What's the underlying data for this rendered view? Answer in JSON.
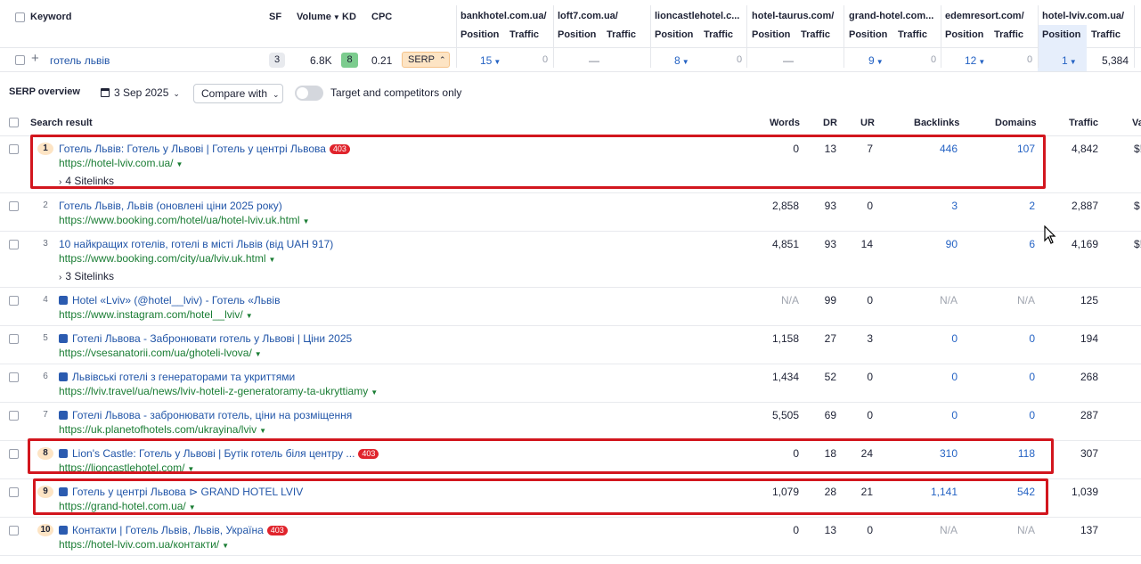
{
  "keyword_table": {
    "headers": {
      "keyword": "Keyword",
      "sf": "SF",
      "volume": "Volume",
      "kd": "KD",
      "cpc": "CPC"
    },
    "competitors": [
      {
        "domain": "bankhotel.com.ua/",
        "position": "15",
        "traffic": "0"
      },
      {
        "domain": "loft7.com.ua/",
        "position": "—",
        "traffic": ""
      },
      {
        "domain": "lioncastlehotel.c...",
        "position": "8",
        "traffic": "0"
      },
      {
        "domain": "hotel-taurus.com/",
        "position": "—",
        "traffic": ""
      },
      {
        "domain": "grand-hotel.com...",
        "position": "9",
        "traffic": "0"
      },
      {
        "domain": "edemresort.com/",
        "position": "12",
        "traffic": "0"
      },
      {
        "domain": "hotel-lviv.com.ua/",
        "position": "1",
        "traffic": "5,384"
      }
    ],
    "sub_headers": {
      "position": "Position",
      "traffic": "Traffic"
    },
    "row": {
      "keyword": "готель львів",
      "sf": "3",
      "volume": "6.8K",
      "kd": "8",
      "cpc": "0.21",
      "serp": "SERP"
    }
  },
  "toolbar": {
    "title": "SERP overview",
    "date": "3 Sep 2025",
    "compare": "Compare with",
    "toggle_label": "Target and competitors only"
  },
  "results_header": {
    "search_result": "Search result",
    "words": "Words",
    "dr": "DR",
    "ur": "UR",
    "backlinks": "Backlinks",
    "domains": "Domains",
    "traffic": "Traffic",
    "value": "Va"
  },
  "results": [
    {
      "rank": "1",
      "title": "Готель Львів: Готель у Львові | Готель у центрі Львова",
      "badge": "403",
      "url": "https://hotel-lviv.com.ua/",
      "sitelinks": "4 Sitelinks",
      "words": "0",
      "dr": "13",
      "ur": "7",
      "backlinks": "446",
      "domains": "107",
      "traffic": "4,842",
      "value": "$!"
    },
    {
      "rank": "2",
      "title": "Готель Львів, Львів (оновлені ціни 2025 року)",
      "url": "https://www.booking.com/hotel/ua/hotel-lviv.uk.html",
      "words": "2,858",
      "dr": "93",
      "ur": "0",
      "backlinks": "3",
      "domains": "2",
      "traffic": "2,887",
      "value": "$"
    },
    {
      "rank": "3",
      "title": "10 найкращих готелів, готелі в місті Львів (від UAH 917)",
      "url": "https://www.booking.com/city/ua/lviv.uk.html",
      "sitelinks": "3 Sitelinks",
      "words": "4,851",
      "dr": "93",
      "ur": "14",
      "backlinks": "90",
      "domains": "6",
      "traffic": "4,169",
      "value": "$!"
    },
    {
      "rank": "4",
      "title": "Hotel «Lviv» (@hotel__lviv) - Готель «Львів",
      "url": "https://www.instagram.com/hotel__lviv/",
      "words": "N/A",
      "dr": "99",
      "ur": "0",
      "backlinks": "N/A",
      "domains": "N/A",
      "traffic": "125",
      "value": ""
    },
    {
      "rank": "5",
      "title": "Готелі Львова - Забронювати готель у Львові | Ціни 2025",
      "url": "https://vsesanatorii.com/ua/ghoteli-lvova/",
      "words": "1,158",
      "dr": "27",
      "ur": "3",
      "backlinks": "0",
      "domains": "0",
      "traffic": "194",
      "value": ""
    },
    {
      "rank": "6",
      "title": "Львівські готелі з генераторами та укриттями",
      "url": "https://lviv.travel/ua/news/lviv-hoteli-z-generatoramy-ta-ukryttiamy",
      "words": "1,434",
      "dr": "52",
      "ur": "0",
      "backlinks": "0",
      "domains": "0",
      "traffic": "268",
      "value": ""
    },
    {
      "rank": "7",
      "title": "Готелі Львова - забронювати готель, ціни на розміщення",
      "url": "https://uk.planetofhotels.com/ukrayina/lviv",
      "words": "5,505",
      "dr": "69",
      "ur": "0",
      "backlinks": "0",
      "domains": "0",
      "traffic": "287",
      "value": ""
    },
    {
      "rank": "8",
      "title": "Lion's Castle: Готель у Львові | Бутік готель біля центру ...",
      "badge": "403",
      "url": "https://lioncastlehotel.com/",
      "words": "0",
      "dr": "18",
      "ur": "24",
      "backlinks": "310",
      "domains": "118",
      "traffic": "307",
      "value": ""
    },
    {
      "rank": "9",
      "title": "Готель у центрі Львова ⊳ GRAND HOTEL LVIV",
      "url": "https://grand-hotel.com.ua/",
      "words": "1,079",
      "dr": "28",
      "ur": "21",
      "backlinks": "1,141",
      "domains": "542",
      "traffic": "1,039",
      "value": ""
    },
    {
      "rank": "10",
      "title": "Контакти | Готель Львів, Львів, Україна",
      "badge": "403",
      "url": "https://hotel-lviv.com.ua/контакти/",
      "words": "0",
      "dr": "13",
      "ur": "0",
      "backlinks": "N/A",
      "domains": "N/A",
      "traffic": "137",
      "value": ""
    }
  ]
}
